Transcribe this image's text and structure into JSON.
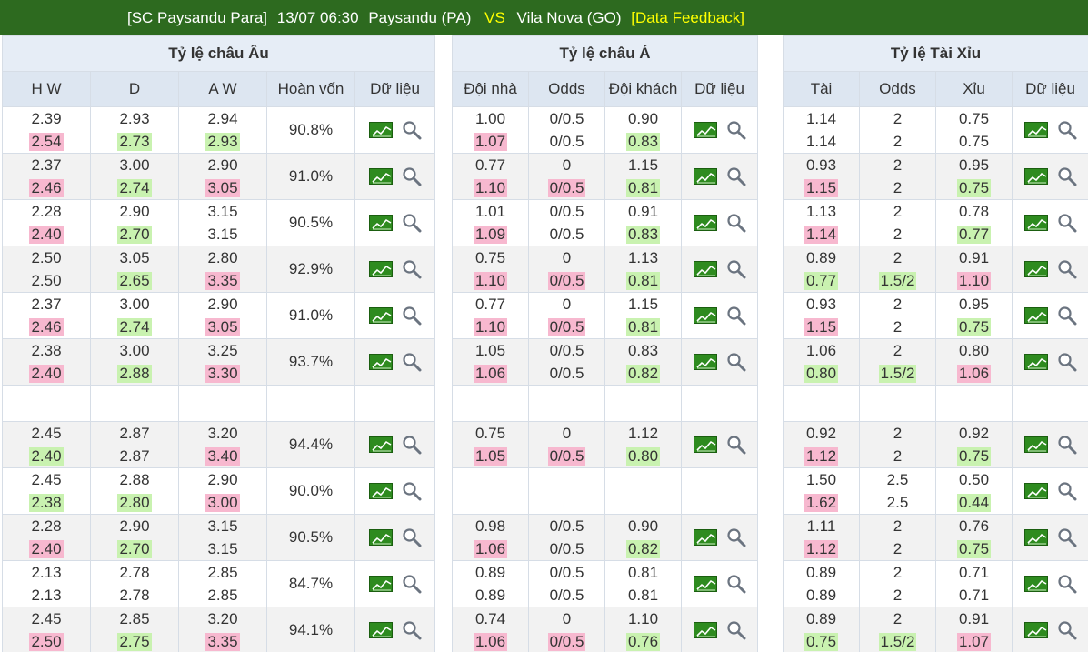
{
  "header": {
    "league": "[SC Paysandu Para]",
    "datetime": "13/07 06:30",
    "home": "Paysandu (PA)",
    "vs": "VS",
    "away": "Vila Nova (GO)",
    "feedback": "[Data Feedback]"
  },
  "colors": {
    "header_bg": "#2d6a1f",
    "up": "#f7b8cf",
    "down": "#c9f2b0"
  },
  "eu": {
    "title": "Tỷ lệ châu Âu",
    "cols": [
      "H W",
      "D",
      "A W",
      "Hoàn vốn",
      "Dữ liệu"
    ],
    "rows": [
      {
        "hw": [
          "2.39",
          "2.54"
        ],
        "hw_c": "up",
        "d": [
          "2.93",
          "2.73"
        ],
        "d_c": "down",
        "aw": [
          "2.94",
          "2.93"
        ],
        "aw_c": "down",
        "ret": "90.8%"
      },
      {
        "hw": [
          "2.37",
          "2.46"
        ],
        "hw_c": "up",
        "d": [
          "3.00",
          "2.74"
        ],
        "d_c": "down",
        "aw": [
          "2.90",
          "3.05"
        ],
        "aw_c": "up",
        "ret": "91.0%"
      },
      {
        "hw": [
          "2.28",
          "2.40"
        ],
        "hw_c": "up",
        "d": [
          "2.90",
          "2.70"
        ],
        "d_c": "down",
        "aw": [
          "3.15",
          "3.15"
        ],
        "aw_c": "",
        "ret": "90.5%"
      },
      {
        "hw": [
          "2.50",
          "2.50"
        ],
        "hw_c": "",
        "d": [
          "3.05",
          "2.65"
        ],
        "d_c": "down",
        "aw": [
          "2.80",
          "3.35"
        ],
        "aw_c": "up",
        "ret": "92.9%"
      },
      {
        "hw": [
          "2.37",
          "2.46"
        ],
        "hw_c": "up",
        "d": [
          "3.00",
          "2.74"
        ],
        "d_c": "down",
        "aw": [
          "2.90",
          "3.05"
        ],
        "aw_c": "up",
        "ret": "91.0%"
      },
      {
        "hw": [
          "2.38",
          "2.40"
        ],
        "hw_c": "up",
        "d": [
          "3.00",
          "2.88"
        ],
        "d_c": "down",
        "aw": [
          "3.25",
          "3.30"
        ],
        "aw_c": "up",
        "ret": "93.7%"
      },
      null,
      {
        "hw": [
          "2.45",
          "2.40"
        ],
        "hw_c": "down",
        "d": [
          "2.87",
          "2.87"
        ],
        "d_c": "",
        "aw": [
          "3.20",
          "3.40"
        ],
        "aw_c": "up",
        "ret": "94.4%"
      },
      {
        "hw": [
          "2.45",
          "2.38"
        ],
        "hw_c": "down",
        "d": [
          "2.88",
          "2.80"
        ],
        "d_c": "down",
        "aw": [
          "2.90",
          "3.00"
        ],
        "aw_c": "up",
        "ret": "90.0%"
      },
      {
        "hw": [
          "2.28",
          "2.40"
        ],
        "hw_c": "up",
        "d": [
          "2.90",
          "2.70"
        ],
        "d_c": "down",
        "aw": [
          "3.15",
          "3.15"
        ],
        "aw_c": "",
        "ret": "90.5%"
      },
      {
        "hw": [
          "2.13",
          "2.13"
        ],
        "hw_c": "",
        "d": [
          "2.78",
          "2.78"
        ],
        "d_c": "",
        "aw": [
          "2.85",
          "2.85"
        ],
        "aw_c": "",
        "ret": "84.7%"
      },
      {
        "hw": [
          "2.45",
          "2.50"
        ],
        "hw_c": "up",
        "d": [
          "2.85",
          "2.75"
        ],
        "d_c": "down",
        "aw": [
          "3.20",
          "3.35"
        ],
        "aw_c": "up",
        "ret": "94.1%"
      }
    ]
  },
  "asia": {
    "title": "Tỷ lệ châu Á",
    "cols": [
      "Đội nhà",
      "Odds",
      "Đội khách",
      "Dữ liệu"
    ],
    "rows": [
      {
        "h": [
          "1.00",
          "1.07"
        ],
        "h_c": "up",
        "o": [
          "0/0.5",
          "0/0.5"
        ],
        "o_c": "",
        "a": [
          "0.90",
          "0.83"
        ],
        "a_c": "down"
      },
      {
        "h": [
          "0.77",
          "1.10"
        ],
        "h_c": "up",
        "o": [
          "0",
          "0/0.5"
        ],
        "o_c": "up",
        "a": [
          "1.15",
          "0.81"
        ],
        "a_c": "down"
      },
      {
        "h": [
          "1.01",
          "1.09"
        ],
        "h_c": "up",
        "o": [
          "0/0.5",
          "0/0.5"
        ],
        "o_c": "",
        "a": [
          "0.91",
          "0.83"
        ],
        "a_c": "down"
      },
      {
        "h": [
          "0.75",
          "1.10"
        ],
        "h_c": "up",
        "o": [
          "0",
          "0/0.5"
        ],
        "o_c": "up",
        "a": [
          "1.13",
          "0.81"
        ],
        "a_c": "down"
      },
      {
        "h": [
          "0.77",
          "1.10"
        ],
        "h_c": "up",
        "o": [
          "0",
          "0/0.5"
        ],
        "o_c": "up",
        "a": [
          "1.15",
          "0.81"
        ],
        "a_c": "down"
      },
      {
        "h": [
          "1.05",
          "1.06"
        ],
        "h_c": "up",
        "o": [
          "0/0.5",
          "0/0.5"
        ],
        "o_c": "",
        "a": [
          "0.83",
          "0.82"
        ],
        "a_c": "down"
      },
      null,
      {
        "h": [
          "0.75",
          "1.05"
        ],
        "h_c": "up",
        "o": [
          "0",
          "0/0.5"
        ],
        "o_c": "up",
        "a": [
          "1.12",
          "0.80"
        ],
        "a_c": "down"
      },
      null,
      {
        "h": [
          "0.98",
          "1.06"
        ],
        "h_c": "up",
        "o": [
          "0/0.5",
          "0/0.5"
        ],
        "o_c": "",
        "a": [
          "0.90",
          "0.82"
        ],
        "a_c": "down"
      },
      {
        "h": [
          "0.89",
          "0.89"
        ],
        "h_c": "",
        "o": [
          "0/0.5",
          "0/0.5"
        ],
        "o_c": "",
        "a": [
          "0.81",
          "0.81"
        ],
        "a_c": ""
      },
      {
        "h": [
          "0.74",
          "1.06"
        ],
        "h_c": "up",
        "o": [
          "0",
          "0/0.5"
        ],
        "o_c": "up",
        "a": [
          "1.10",
          "0.76"
        ],
        "a_c": "down"
      }
    ]
  },
  "ou": {
    "title": "Tỷ lệ Tài Xỉu",
    "cols": [
      "Tài",
      "Odds",
      "Xỉu",
      "Dữ liệu"
    ],
    "rows": [
      {
        "t": [
          "1.14",
          "1.14"
        ],
        "t_c": "",
        "o": [
          "2",
          "2"
        ],
        "o_c": "",
        "x": [
          "0.75",
          "0.75"
        ],
        "x_c": ""
      },
      {
        "t": [
          "0.93",
          "1.15"
        ],
        "t_c": "up",
        "o": [
          "2",
          "2"
        ],
        "o_c": "",
        "x": [
          "0.95",
          "0.75"
        ],
        "x_c": "down"
      },
      {
        "t": [
          "1.13",
          "1.14"
        ],
        "t_c": "up",
        "o": [
          "2",
          "2"
        ],
        "o_c": "",
        "x": [
          "0.78",
          "0.77"
        ],
        "x_c": "down"
      },
      {
        "t": [
          "0.89",
          "0.77"
        ],
        "t_c": "down",
        "o": [
          "2",
          "1.5/2"
        ],
        "o_c": "down",
        "x": [
          "0.91",
          "1.10"
        ],
        "x_c": "up"
      },
      {
        "t": [
          "0.93",
          "1.15"
        ],
        "t_c": "up",
        "o": [
          "2",
          "2"
        ],
        "o_c": "",
        "x": [
          "0.95",
          "0.75"
        ],
        "x_c": "down"
      },
      {
        "t": [
          "1.06",
          "0.80"
        ],
        "t_c": "down",
        "o": [
          "2",
          "1.5/2"
        ],
        "o_c": "down",
        "x": [
          "0.80",
          "1.06"
        ],
        "x_c": "up"
      },
      null,
      {
        "t": [
          "0.92",
          "1.12"
        ],
        "t_c": "up",
        "o": [
          "2",
          "2"
        ],
        "o_c": "",
        "x": [
          "0.92",
          "0.75"
        ],
        "x_c": "down"
      },
      {
        "t": [
          "1.50",
          "1.62"
        ],
        "t_c": "up",
        "o": [
          "2.5",
          "2.5"
        ],
        "o_c": "",
        "x": [
          "0.50",
          "0.44"
        ],
        "x_c": "down"
      },
      {
        "t": [
          "1.11",
          "1.12"
        ],
        "t_c": "up",
        "o": [
          "2",
          "2"
        ],
        "o_c": "",
        "x": [
          "0.76",
          "0.75"
        ],
        "x_c": "down"
      },
      {
        "t": [
          "0.89",
          "0.89"
        ],
        "t_c": "",
        "o": [
          "2",
          "2"
        ],
        "o_c": "",
        "x": [
          "0.71",
          "0.71"
        ],
        "x_c": ""
      },
      {
        "t": [
          "0.89",
          "0.75"
        ],
        "t_c": "down",
        "o": [
          "2",
          "1.5/2"
        ],
        "o_c": "down",
        "x": [
          "0.91",
          "1.07"
        ],
        "x_c": "up"
      }
    ]
  },
  "icons": {
    "chart": "chart-icon",
    "search": "search-icon"
  }
}
